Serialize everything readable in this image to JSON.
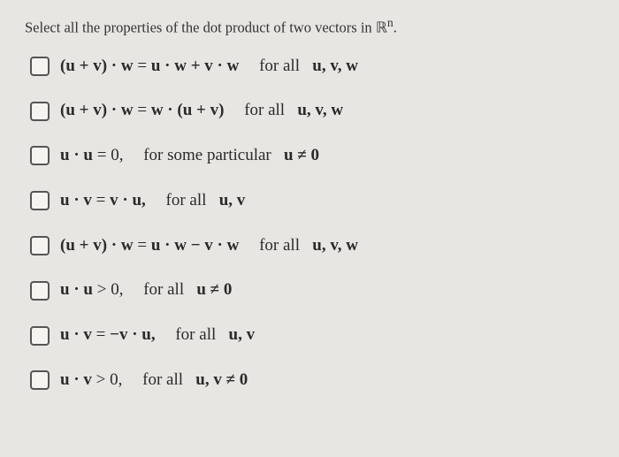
{
  "prompt": {
    "text_before": "Select all the properties of the dot product of two vectors in ",
    "set_symbol": "ℝ",
    "exponent": "n",
    "period": "."
  },
  "options": [
    {
      "lhs": "(u + v) · w",
      "eq": " = ",
      "rhs": "u · w + v · w",
      "quantifier": "for all",
      "vars": "u, v, w"
    },
    {
      "lhs": "(u + v) · w",
      "eq": " = ",
      "rhs": "w · (u + v)",
      "quantifier": "for all",
      "vars": "u, v, w"
    },
    {
      "lhs": "u · u",
      "eq": " = ",
      "rhs_plain": "0,",
      "quantifier": "for some particular",
      "vars": "u ≠ 0"
    },
    {
      "lhs": "u · v",
      "eq": " = ",
      "rhs": "v · u,",
      "quantifier": "for all",
      "vars": "u, v"
    },
    {
      "lhs": "(u + v) · w",
      "eq": " = ",
      "rhs": "u · w − v · w",
      "quantifier": "for all",
      "vars": "u, v, w"
    },
    {
      "lhs": "u · u",
      "eq": " > ",
      "rhs_plain": "0,",
      "quantifier": "for all",
      "vars": "u ≠ 0"
    },
    {
      "lhs": "u · v",
      "eq": " = ",
      "rhs": "−v · u,",
      "quantifier": "for all",
      "vars": "u, v"
    },
    {
      "lhs": "u · v",
      "eq": " > ",
      "rhs_plain": "0,",
      "quantifier": "for all",
      "vars": "u, v ≠ 0"
    }
  ]
}
